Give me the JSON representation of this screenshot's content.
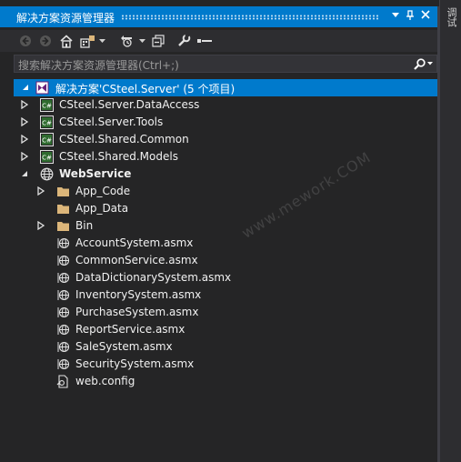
{
  "window": {
    "title": "解决方案资源管理器",
    "dropdown_icon": "dropdown-arrow-icon",
    "pin_icon": "pin-icon",
    "close_icon": "close-icon"
  },
  "side_tab": {
    "label": "调试"
  },
  "toolbar": {
    "icons": [
      "back-icon",
      "forward-icon",
      "home-icon",
      "switch-views-icon",
      "dropdown-icon",
      "pending-changes-filter-icon",
      "dropdown-icon",
      "collapse-all-icon",
      "properties-icon",
      "preview-icon"
    ]
  },
  "search": {
    "placeholder": "搜索解决方案资源管理器(Ctrl+;)"
  },
  "tree": {
    "solution": "解决方案'CSteel.Server' (5 个项目)",
    "projects": [
      {
        "label": "CSteel.Server.DataAccess",
        "icon": "csharp-project-icon"
      },
      {
        "label": "CSteel.Server.Tools",
        "icon": "csharp-project-icon"
      },
      {
        "label": "CSteel.Shared.Common",
        "icon": "csharp-project-icon"
      },
      {
        "label": "CSteel.Shared.Models",
        "icon": "csharp-project-icon"
      }
    ],
    "web_project": {
      "label": "WebService",
      "folders": [
        "App_Code",
        "App_Data",
        "Bin"
      ],
      "files": [
        "AccountSystem.asmx",
        "CommonService.asmx",
        "DataDictionarySystem.asmx",
        "InventorySystem.asmx",
        "PurchaseSystem.asmx",
        "ReportService.asmx",
        "SaleSystem.asmx",
        "SecuritySystem.asmx"
      ],
      "config": "web.config"
    }
  },
  "watermark": "www.mework.COM",
  "colors": {
    "accent": "#007acc",
    "background": "#252526",
    "folder": "#dcb67a"
  }
}
